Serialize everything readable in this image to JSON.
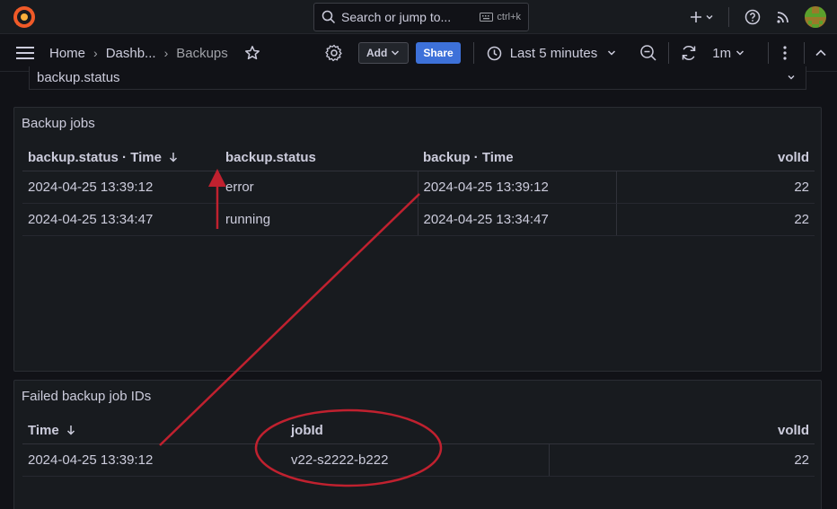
{
  "topbar": {
    "search_placeholder": "Search or jump to...",
    "search_shortcut": "ctrl+k",
    "icons": [
      "grafana-logo-icon",
      "search-icon",
      "keyboard-icon",
      "plus-icon",
      "chevron-down-icon",
      "help-icon",
      "rss-icon",
      "avatar"
    ]
  },
  "navbar": {
    "breadcrumb": [
      "Home",
      "Dashb...",
      "Backups"
    ],
    "add_label": "Add",
    "share_label": "Share",
    "time_range": "Last 5 minutes",
    "refresh_interval": "1m"
  },
  "variable": {
    "value": "backup.status"
  },
  "panels": [
    {
      "title": "Backup jobs",
      "columns": [
        "backup.status · Time",
        "backup.status",
        "backup · Time",
        "volId"
      ],
      "rows": [
        [
          "2024-04-25 13:39:12",
          "error",
          "2024-04-25 13:39:12",
          "22"
        ],
        [
          "2024-04-25 13:34:47",
          "running",
          "2024-04-25 13:34:47",
          "22"
        ]
      ]
    },
    {
      "title": "Failed backup job IDs",
      "columns": [
        "Time",
        "jobId",
        "volId"
      ],
      "rows": [
        [
          "2024-04-25 13:39:12",
          "v22-s2222-b222",
          "22"
        ]
      ]
    }
  ],
  "colors": {
    "background": "#111217",
    "panel": "#181b1f",
    "primary_button": "#3d71d9",
    "annotation": "#c0212f",
    "logo": "#f05a28"
  }
}
